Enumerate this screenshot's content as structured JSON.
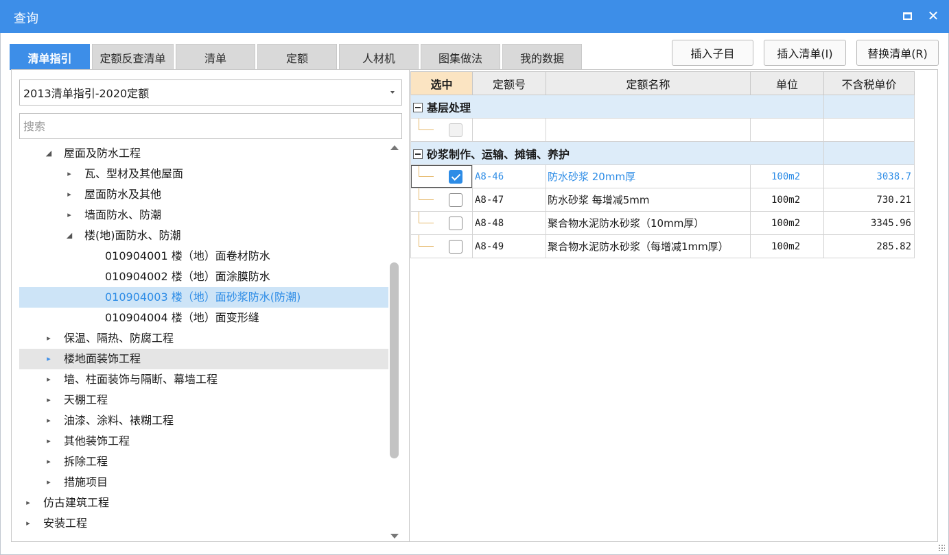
{
  "window": {
    "title": "查询"
  },
  "tabs": [
    {
      "label": "清单指引",
      "active": true
    },
    {
      "label": "定额反查清单",
      "active": false
    },
    {
      "label": "清单",
      "active": false
    },
    {
      "label": "定额",
      "active": false
    },
    {
      "label": "人材机",
      "active": false
    },
    {
      "label": "图集做法",
      "active": false
    },
    {
      "label": "我的数据",
      "active": false
    }
  ],
  "actions": {
    "insert_child": "插入子目",
    "insert_list": "插入清单(I)",
    "replace_list": "替换清单(R)"
  },
  "left": {
    "dropdown_value": "2013清单指引-2020定额",
    "search_placeholder": "搜索",
    "tree": [
      {
        "arrow": "▲",
        "label": "屋面及防水工程",
        "level": 1,
        "state": ""
      },
      {
        "arrow": "▸",
        "label": "瓦、型材及其他屋面",
        "level": 2,
        "state": ""
      },
      {
        "arrow": "▸",
        "label": "屋面防水及其他",
        "level": 2,
        "state": ""
      },
      {
        "arrow": "▸",
        "label": "墙面防水、防潮",
        "level": 2,
        "state": ""
      },
      {
        "arrow": "▲",
        "label": "楼(地)面防水、防潮",
        "level": 2,
        "state": ""
      },
      {
        "arrow": "",
        "label": "010904001  楼（地）面卷材防水",
        "level": 3,
        "state": ""
      },
      {
        "arrow": "",
        "label": "010904002  楼（地）面涂膜防水",
        "level": 3,
        "state": ""
      },
      {
        "arrow": "",
        "label": "010904003  楼（地）面砂浆防水(防潮)",
        "level": 3,
        "state": "selected"
      },
      {
        "arrow": "",
        "label": "010904004  楼（地）面变形缝",
        "level": 3,
        "state": ""
      },
      {
        "arrow": "▸",
        "label": "保温、隔热、防腐工程",
        "level": 1,
        "state": ""
      },
      {
        "arrow": "▸",
        "label": "楼地面装饰工程",
        "level": 1,
        "state": "hover"
      },
      {
        "arrow": "▸",
        "label": "墙、柱面装饰与隔断、幕墙工程",
        "level": 1,
        "state": ""
      },
      {
        "arrow": "▸",
        "label": "天棚工程",
        "level": 1,
        "state": ""
      },
      {
        "arrow": "▸",
        "label": "油漆、涂料、裱糊工程",
        "level": 1,
        "state": ""
      },
      {
        "arrow": "▸",
        "label": "其他装饰工程",
        "level": 1,
        "state": ""
      },
      {
        "arrow": "▸",
        "label": "拆除工程",
        "level": 1,
        "state": ""
      },
      {
        "arrow": "▸",
        "label": "措施项目",
        "level": 1,
        "state": ""
      },
      {
        "arrow": "▸",
        "label": "仿古建筑工程",
        "level": 0,
        "state": ""
      },
      {
        "arrow": "▸",
        "label": "安装工程",
        "level": 0,
        "state": ""
      }
    ]
  },
  "grid": {
    "headers": [
      "选中",
      "定额号",
      "定额名称",
      "单位",
      "不含税单价"
    ],
    "groups": [
      {
        "name": "基层处理",
        "rows": [
          {
            "checked": false,
            "disabled": true,
            "code": "",
            "name": "",
            "unit": "",
            "price": ""
          }
        ]
      },
      {
        "name": "砂浆制作、运输、摊铺、养护",
        "rows": [
          {
            "checked": true,
            "disabled": false,
            "active": true,
            "code": "A8-46",
            "name": "防水砂浆 20mm厚",
            "unit": "100m2",
            "price": "3038.7"
          },
          {
            "checked": false,
            "disabled": false,
            "code": "A8-47",
            "name": "防水砂浆 每增减5mm",
            "unit": "100m2",
            "price": "730.21"
          },
          {
            "checked": false,
            "disabled": false,
            "code": "A8-48",
            "name": "聚合物水泥防水砂浆（10mm厚）",
            "unit": "100m2",
            "price": "3345.96"
          },
          {
            "checked": false,
            "disabled": false,
            "code": "A8-49",
            "name": "聚合物水泥防水砂浆（每增减1mm厚）",
            "unit": "100m2",
            "price": "285.82"
          }
        ]
      }
    ]
  },
  "colors": {
    "accent": "#3d8ee8",
    "selected_text": "#2d8ce6",
    "group_bg": "#ddecf9",
    "header_selected": "#fbe4c2"
  }
}
